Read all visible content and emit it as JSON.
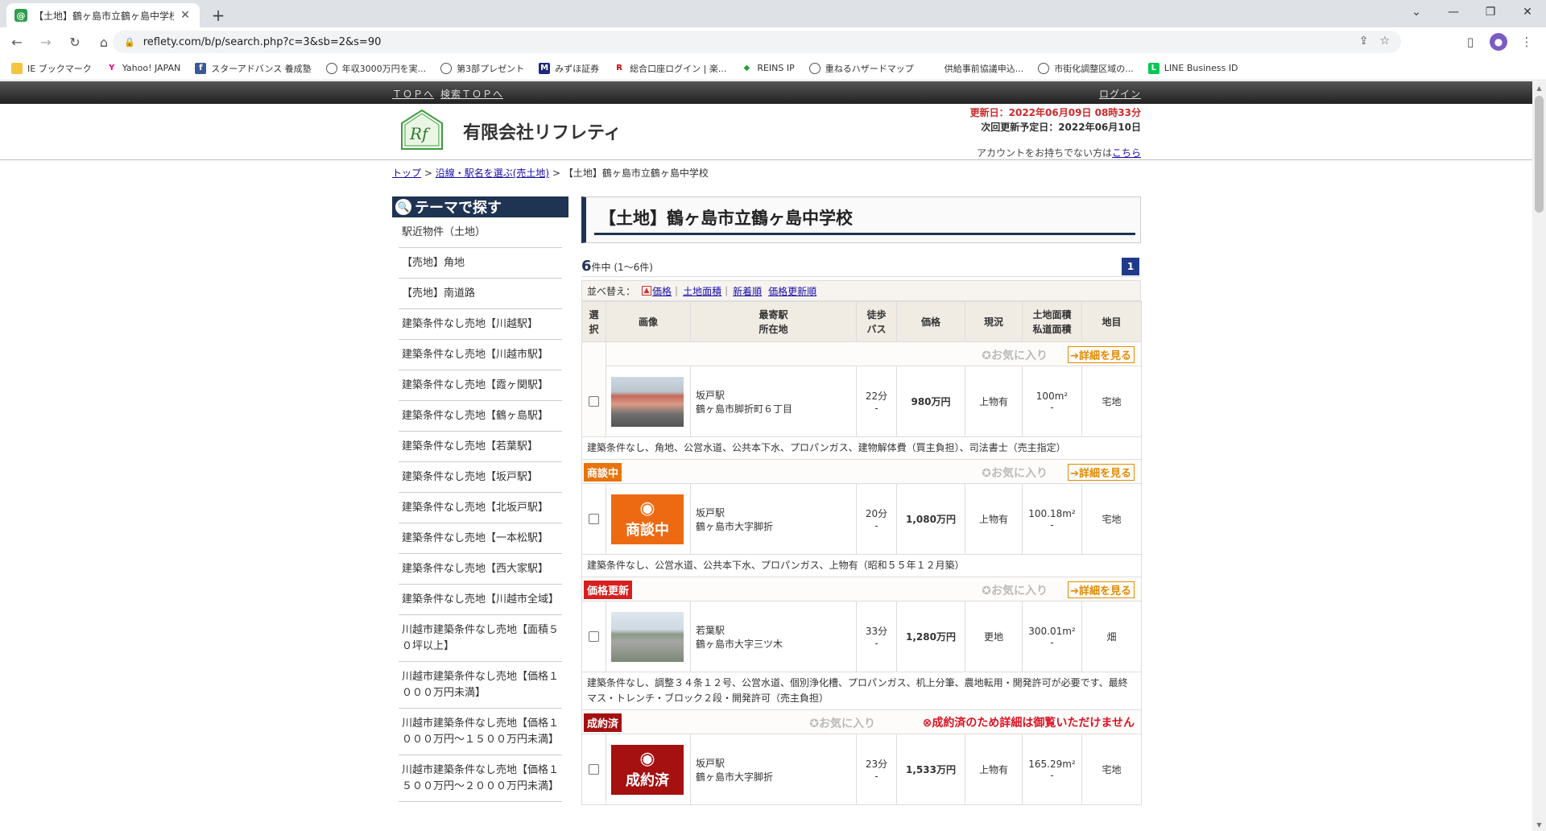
{
  "browser": {
    "tab_title": "【土地】鶴ヶ島市立鶴ヶ島中学校の",
    "url": "reflety.com/b/p/search.php?c=3&sb=2&s=90",
    "bookmarks": [
      "IE ブックマーク",
      "Yahoo! JAPAN",
      "スターアドバンス 養成塾",
      "年収3000万円を実...",
      "第3部プレゼント",
      "みずほ証券",
      "総合口座ログイン | 楽...",
      "REINS IP",
      "重ねるハザードマップ",
      "供給事前協議申込...",
      "市街化調整区域の...",
      "LINE Business ID"
    ]
  },
  "topbar": {
    "top": "ＴＯＰへ",
    "search_top": "検索ＴＯＰへ",
    "login": "ログイン"
  },
  "header": {
    "company": "有限会社リフレティ",
    "updated": "更新日：2022年06月09日 08時33分",
    "next_update": "次回更新予定日：2022年06月10日",
    "account_prefix": "アカウントをお持ちでない方は",
    "account_link": "こちら"
  },
  "breadcrumb": {
    "home": "トップ",
    "sep": ">",
    "section": "沿線・駅名を選ぶ(売土地)",
    "current": "【土地】鶴ヶ島市立鶴ヶ島中学校"
  },
  "sidebar": {
    "title": "テーマで探す",
    "items": [
      "駅近物件（土地）",
      "【売地】角地",
      "【売地】南道路",
      "建築条件なし売地【川越駅】",
      "建築条件なし売地【川越市駅】",
      "建築条件なし売地【霞ヶ関駅】",
      "建築条件なし売地【鶴ヶ島駅】",
      "建築条件なし売地【若葉駅】",
      "建築条件なし売地【坂戸駅】",
      "建築条件なし売地【北坂戸駅】",
      "建築条件なし売地【一本松駅】",
      "建築条件なし売地【西大家駅】",
      "建築条件なし売地【川越市全域】",
      "川越市建築条件なし売地【面積５０坪以上】",
      "川越市建築条件なし売地【価格１０００万円未満】",
      "川越市建築条件なし売地【価格１０００万円～１５００万円未満】",
      "川越市建築条件なし売地【価格１５００万円～２０００万円未満】"
    ]
  },
  "main": {
    "title": "【土地】鶴ヶ島市立鶴ヶ島中学校",
    "count": "6",
    "count_suffix": "件中 (1～6件)",
    "page": "1",
    "sort_label": "並べ替え：",
    "sort": [
      "価格",
      "土地面積",
      "新着順",
      "価格更新順"
    ],
    "sort_tri": "▲",
    "headers": [
      "選択",
      "画像",
      "最寄駅\n所在地",
      "徒歩\nバス",
      "価格",
      "現況",
      "土地面積\n私道面積",
      "地目"
    ],
    "fav_label": "お気に入り",
    "detail_label": "詳細を見る",
    "sold_message": "成約済のため詳細は御覧いただけません",
    "listings": [
      {
        "badge": "",
        "badge_color": "",
        "station": "坂戸駅",
        "address": "鶴ヶ島市脚折町６丁目",
        "walk": "22分",
        "bus": "-",
        "price": "980万円",
        "status": "上物有",
        "area": "100m²",
        "private_area": "-",
        "land_type": "宅地",
        "note": "建築条件なし、角地、公営水道、公共本下水、プロパンガス、建物解体費（買主負担）、司法書士（売主指定）",
        "thumb": "photo",
        "sold": false
      },
      {
        "badge": "商談中",
        "badge_color": "#e8740c",
        "station": "坂戸駅",
        "address": "鶴ヶ島市大字脚折",
        "walk": "20分",
        "bus": "-",
        "price": "1,080万円",
        "status": "上物有",
        "area": "100.18m²",
        "private_area": "-",
        "land_type": "宅地",
        "note": "建築条件なし、公営水道、公共本下水、プロパンガス、上物有（昭和５５年１２月築）",
        "thumb": "商談中",
        "sold": false
      },
      {
        "badge": "価格更新",
        "badge_color": "#d61f1f",
        "station": "若葉駅",
        "address": "鶴ヶ島市大字三ツ木",
        "walk": "33分",
        "bus": "-",
        "price": "1,280万円",
        "status": "更地",
        "area": "300.01m²",
        "private_area": "-",
        "land_type": "畑",
        "note": "建築条件なし、調整３４条１２号、公営水道、個別浄化槽、プロパンガス、机上分筆、農地転用・開発許可が必要です、最終マス・トレンチ・ブロック２段・開発許可（売主負担）",
        "thumb": "photo2",
        "sold": false
      },
      {
        "badge": "成約済",
        "badge_color": "#a51010",
        "station": "坂戸駅",
        "address": "鶴ヶ島市大字脚折",
        "walk": "23分",
        "bus": "-",
        "price": "1,533万円",
        "status": "上物有",
        "area": "165.29m²",
        "private_area": "-",
        "land_type": "宅地",
        "note": "",
        "thumb": "成約済",
        "sold": true
      }
    ]
  }
}
